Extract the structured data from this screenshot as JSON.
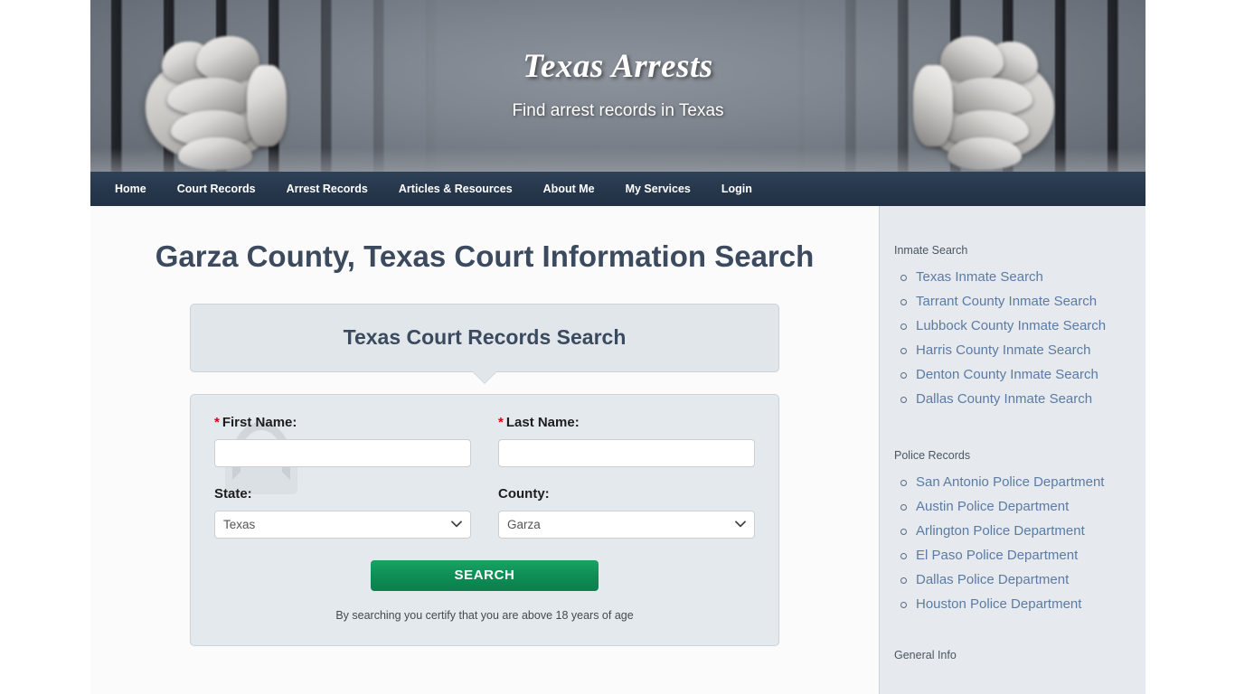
{
  "site": {
    "title": "Texas Arrests",
    "tagline": "Find arrest records in Texas"
  },
  "nav": {
    "items": [
      {
        "label": "Home"
      },
      {
        "label": "Court Records"
      },
      {
        "label": "Arrest Records"
      },
      {
        "label": "Articles & Resources"
      },
      {
        "label": "About Me"
      },
      {
        "label": "My Services"
      },
      {
        "label": "Login"
      }
    ]
  },
  "main": {
    "page_title": "Garza County, Texas Court Information Search",
    "widget": {
      "header_title": "Texas Court Records Search",
      "first_name_label": "First Name:",
      "last_name_label": "Last Name:",
      "state_label": "State:",
      "county_label": "County:",
      "required_marker": "*",
      "first_name_value": "",
      "last_name_value": "",
      "first_name_placeholder": "",
      "last_name_placeholder": "",
      "state_value": "Texas",
      "state_options": [
        "Texas"
      ],
      "county_value": "Garza",
      "county_options": [
        "Garza"
      ],
      "search_button": "SEARCH",
      "disclaimer": "By searching you certify that you are above 18 years of age",
      "chevron_glyph": "⌄"
    }
  },
  "sidebar": {
    "sections": [
      {
        "heading": "Inmate Search",
        "links": [
          "Texas Inmate Search",
          "Tarrant County Inmate Search",
          "Lubbock County Inmate Search",
          "Harris County Inmate Search",
          "Denton County Inmate Search",
          "Dallas County Inmate Search"
        ]
      },
      {
        "heading": "Police Records",
        "links": [
          "San Antonio Police Department",
          "Austin Police Department",
          "Arlington Police Department",
          "El Paso Police Department",
          "Dallas Police Department",
          "Houston Police Department"
        ]
      },
      {
        "heading": "General Info",
        "links": []
      }
    ]
  },
  "colors": {
    "nav_bg": "#27374b",
    "title_text": "#3b4a5e",
    "link_blue": "#5b7ba4",
    "search_green": "#0e8e55",
    "required_red": "#d0021b",
    "sidebar_bg": "#e6eaee",
    "form_bg": "#e4e9ed"
  }
}
